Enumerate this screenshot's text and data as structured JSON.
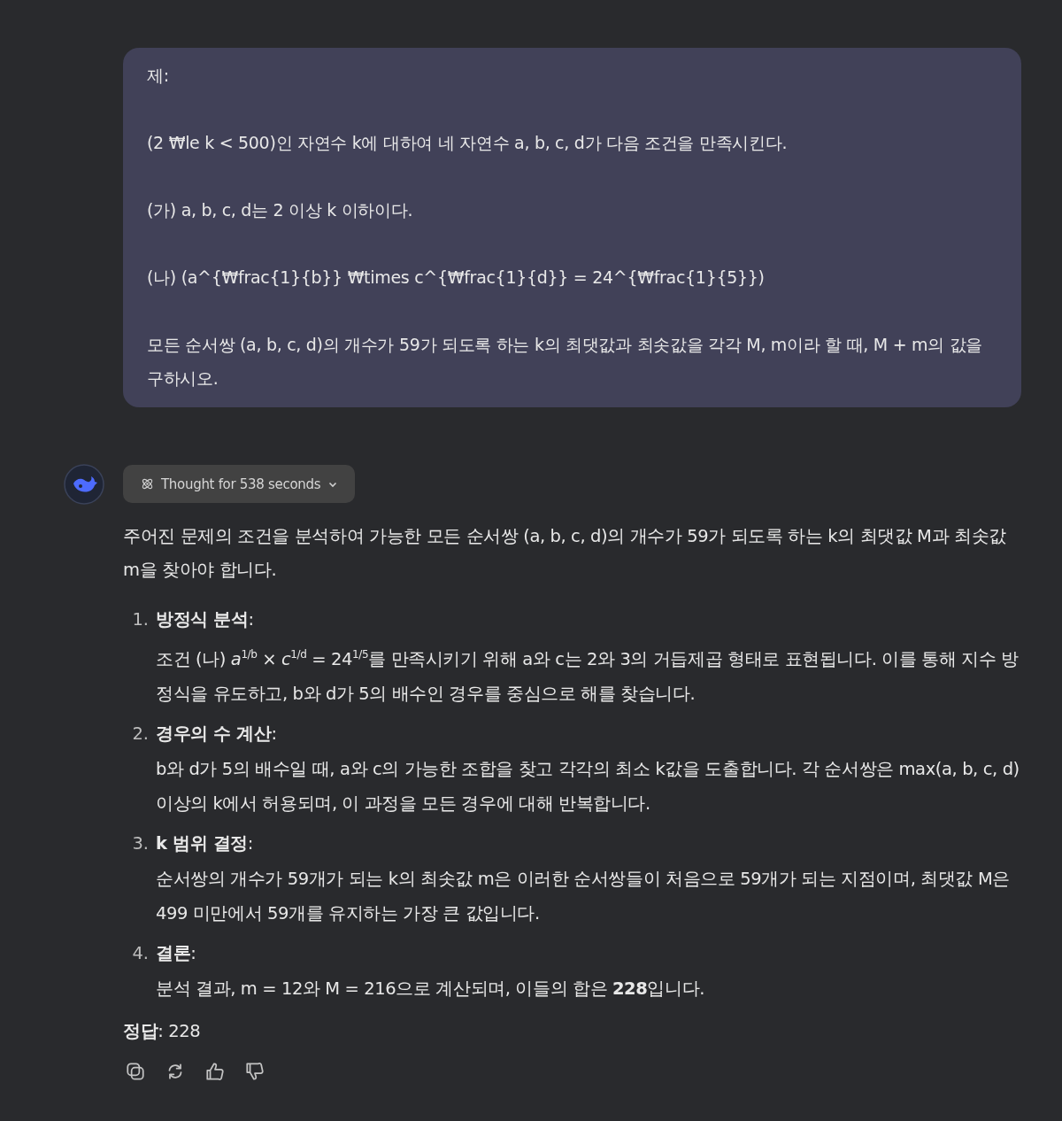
{
  "user_message": {
    "paragraphs": [
      "제:",
      "(2 ₩le k < 500)인 자연수 k에 대하여 네 자연수 a, b, c, d가 다음 조건을 만족시킨다.",
      "(가) a, b, c, d는 2 이상 k 이하이다.",
      "(나) (a^{₩frac{1}{b}} ₩times c^{₩frac{1}{d}} = 24^{₩frac{1}{5}})",
      "모든 순서쌍 (a, b, c, d)의 개수가 59가 되도록 하는 k의 최댓값과 최솟값을 각각 M, m이라 할 때, M + m의 값을 구하시오."
    ]
  },
  "thought_button": {
    "label": "Thought for 538 seconds",
    "expanded": false
  },
  "answer": {
    "intro": "주어진 문제의 조건을 분석하여 가능한 모든 순서쌍 (a, b, c, d)의 개수가 59가 되도록 하는 k의 최댓값 M과 최솟값 m을 찾아야 합니다.",
    "steps": [
      {
        "number": "1.",
        "title": "**방정식 분석**:",
        "body": "조건 (나) *a*$^{1/b}$ × *c*$^{1/d}$ = 24$^{1/5}$를 만족시키기 위해 a와 c는 2와 3의 거듭제곱 형태로 표현됩니다. 이를 통해 지수 방정식을 유도하고, b와 d가 5의 배수인 경우를 중심으로 해를 찾습니다."
      },
      {
        "number": "2.",
        "title": "**경우의 수 계산**:",
        "body": "b와 d가 5의 배수일 때, a와 c의 가능한 조합을 찾고 각각의 최소 k값을 도출합니다. 각 순서쌍은 max(a, b, c, d) 이상의 k에서 허용되며, 이 과정을 모든 경우에 대해 반복합니다."
      },
      {
        "number": "3.",
        "title": "**k 범위 결정**:",
        "body": "순서쌍의 개수가 59개가 되는 k의 최솟값 m은 이러한 순서쌍들이 처음으로 59개가 되는 지점이며, 최댓값 M은 499 미만에서 59개를 유지하는 가장 큰 값입니다."
      },
      {
        "number": "4.",
        "title": "**결론**:",
        "body": "분석 결과, m = 12와 M = 216으로 계산되며, 이들의 합은 **228**입니다."
      }
    ],
    "final": "**정답**: 228"
  },
  "actions": [
    {
      "kind": "copy"
    },
    {
      "kind": "regenerate"
    },
    {
      "kind": "like"
    },
    {
      "kind": "dislike"
    }
  ]
}
